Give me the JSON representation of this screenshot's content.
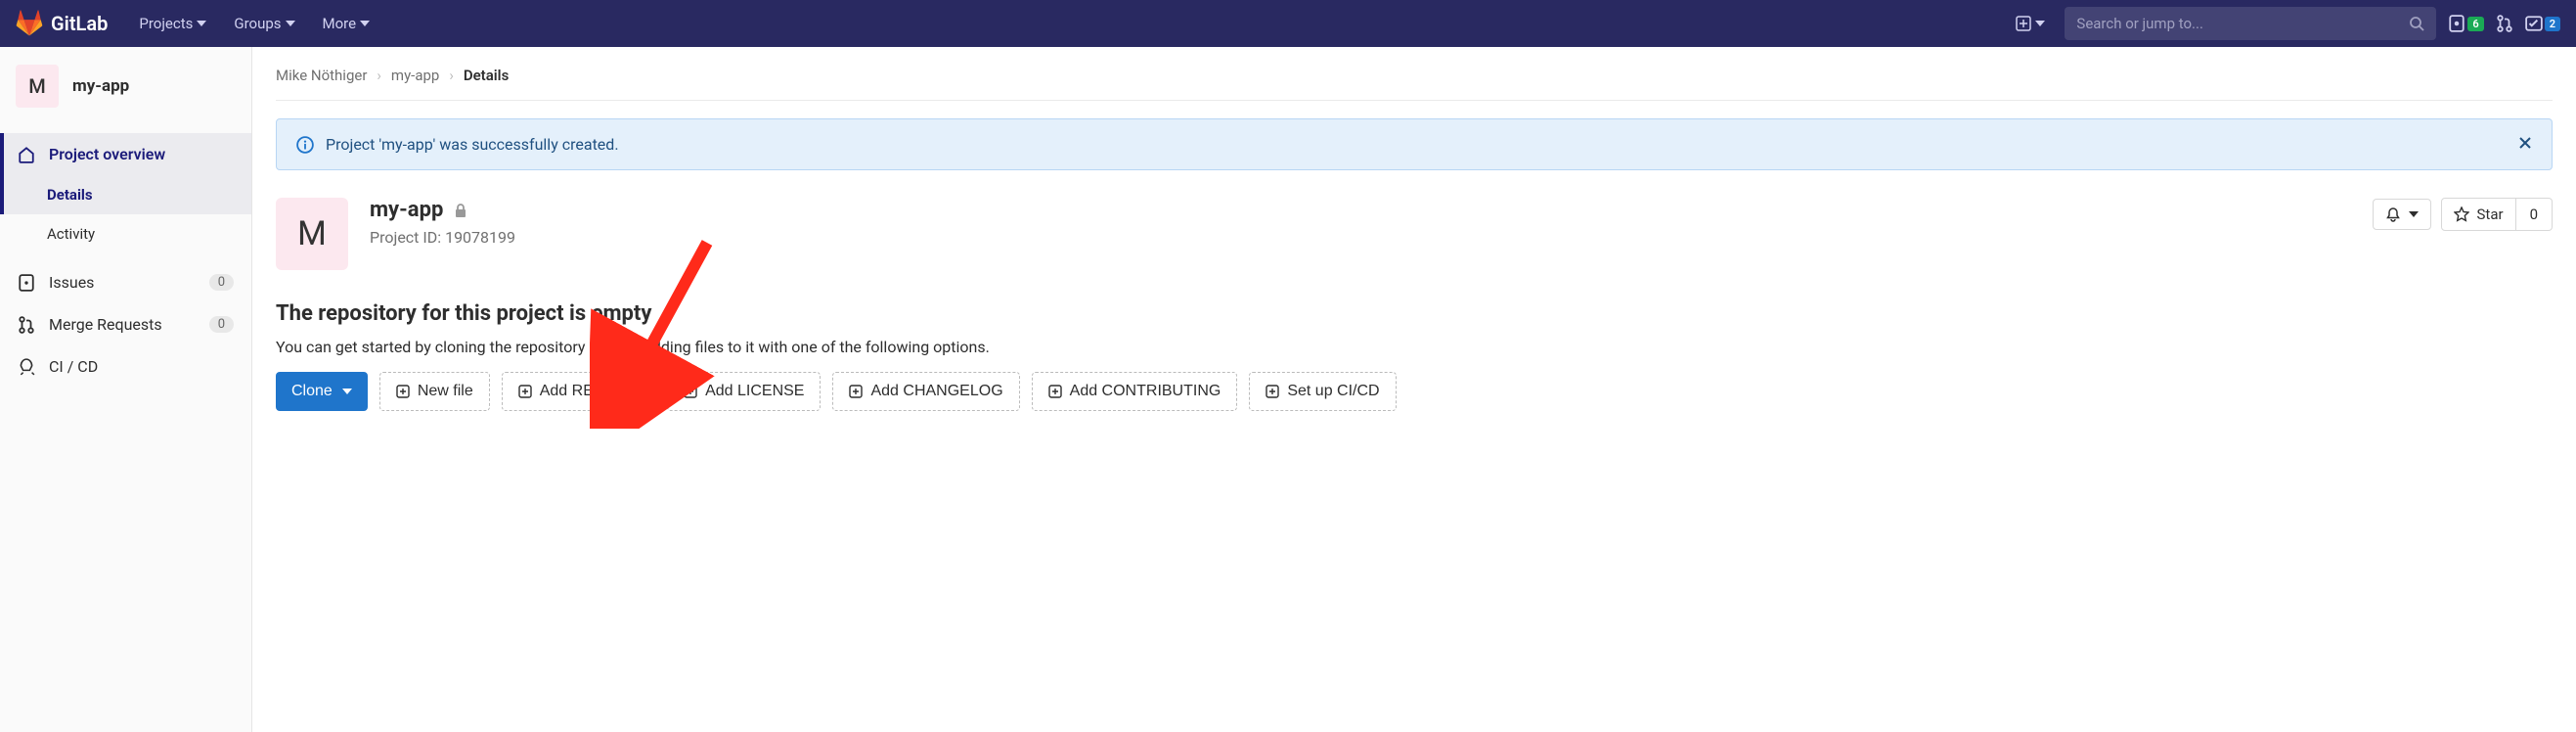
{
  "header": {
    "brand": "GitLab",
    "nav": [
      "Projects",
      "Groups",
      "More"
    ],
    "search_placeholder": "Search or jump to...",
    "issues_badge": "6",
    "todos_badge": "2"
  },
  "sidebar": {
    "project": {
      "initial": "M",
      "name": "my-app"
    },
    "overview_label": "Project overview",
    "subitems": [
      "Details",
      "Activity"
    ],
    "items": [
      {
        "icon": "issues",
        "label": "Issues",
        "badge": "0"
      },
      {
        "icon": "merge",
        "label": "Merge Requests",
        "badge": "0"
      },
      {
        "icon": "cicd",
        "label": "CI / CD"
      }
    ]
  },
  "breadcrumbs": [
    "Mike Nöthiger",
    "my-app",
    "Details"
  ],
  "alert": {
    "text": "Project 'my-app' was successfully created."
  },
  "hero": {
    "initial": "M",
    "title": "my-app",
    "project_id": "Project ID: 19078199",
    "star_label": "Star",
    "star_count": "0"
  },
  "empty": {
    "title": "The repository for this project is empty",
    "subtitle": "You can get started by cloning the repository or start adding files to it with one of the following options."
  },
  "actions": {
    "clone": "Clone",
    "buttons": [
      "New file",
      "Add README",
      "Add LICENSE",
      "Add CHANGELOG",
      "Add CONTRIBUTING",
      "Set up CI/CD"
    ]
  }
}
